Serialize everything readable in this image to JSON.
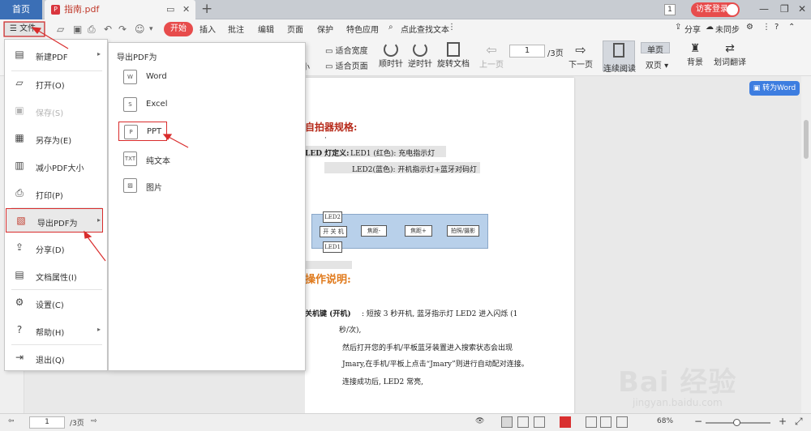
{
  "tabbar": {
    "home": "首页",
    "doc_name": "指南.pdf",
    "badge": "1",
    "guest_login": "访客登录"
  },
  "menubar": {
    "file": "文件",
    "start": "开始",
    "tabs": [
      "插入",
      "批注",
      "编辑",
      "页面",
      "保护",
      "特色应用"
    ],
    "search": "点此查找文本",
    "share": "分享",
    "sync": "未同步"
  },
  "ribbon": {
    "fit_width": "适合宽度",
    "fit_page": "适合页面",
    "shrink_suffix": "小",
    "clockwise": "顺时针",
    "counter_clockwise": "逆时针",
    "rotate_doc": "旋转文档",
    "prev_page": "上一页",
    "page_value": "1",
    "page_total": "/3页",
    "next_page": "下一页",
    "continuous": "连续阅读",
    "single": "单页",
    "double": "双页",
    "background": "背景",
    "translate": "划词翻译"
  },
  "file_menu": {
    "items": [
      {
        "label": "新建PDF",
        "icon": "new-pdf-icon"
      },
      {
        "label": "打开(O)",
        "icon": "folder-icon"
      },
      {
        "label": "保存(S)",
        "icon": "save-icon"
      },
      {
        "label": "另存为(E)",
        "icon": "save-as-icon"
      },
      {
        "label": "减小PDF大小",
        "icon": "compress-icon"
      },
      {
        "label": "打印(P)",
        "icon": "print-icon"
      },
      {
        "label": "导出PDF为",
        "icon": "export-icon"
      },
      {
        "label": "分享(D)",
        "icon": "share-icon"
      },
      {
        "label": "文档属性(I)",
        "icon": "properties-icon"
      },
      {
        "label": "设置(C)",
        "icon": "settings-icon"
      },
      {
        "label": "帮助(H)",
        "icon": "help-icon"
      },
      {
        "label": "退出(Q)",
        "icon": "exit-icon"
      }
    ]
  },
  "export_menu": {
    "title": "导出PDF为",
    "items": [
      {
        "label": "Word",
        "icon": "word-icon"
      },
      {
        "label": "Excel",
        "icon": "excel-icon"
      },
      {
        "label": "PPT",
        "icon": "ppt-icon"
      },
      {
        "label": "纯文本",
        "icon": "text-icon"
      },
      {
        "label": "图片",
        "icon": "image-icon"
      }
    ]
  },
  "document": {
    "heading1": "自拍器规格:",
    "bullet": "·",
    "led_label": "LED 灯定义:",
    "led_line1": "LED1 (红色): 充电指示灯",
    "led_line2": "LED2(蓝色): 开机指示灯+蓝牙对码灯",
    "diagram": {
      "led2": "LED2",
      "power": "开 关 机",
      "focus_minus": "焦距-",
      "focus_plus": "焦距+",
      "shoot": "拍照/摄影",
      "led1": "LED1"
    },
    "heading2": "操作说明:",
    "p1_bold": "关机键 (开机)",
    "p1": ": 短按 3 秒开机, 蓝牙指示灯 LED2 进入闪烁 (1",
    "p1b": "秒/次),",
    "p2": "然后打开您的手机/平板蓝牙装置进入搜索状态会出现",
    "p3": "Jmary,在手机/平板上点击“Jmary”则进行自动配对连接。",
    "p4": "连接成功后, LED2 常亮,",
    "to_word": "转为Word"
  },
  "status": {
    "page_value": "1",
    "page_total": "/3页",
    "zoom": "68%"
  },
  "watermark": {
    "brand": "Bai 经验",
    "url": "jingyan.baidu.com"
  },
  "colors": {
    "accent_red": "#e74c4c",
    "home_blue": "#3b6fb6",
    "word_blue": "#3d7de0",
    "highlight_border": "#d92c2c"
  }
}
